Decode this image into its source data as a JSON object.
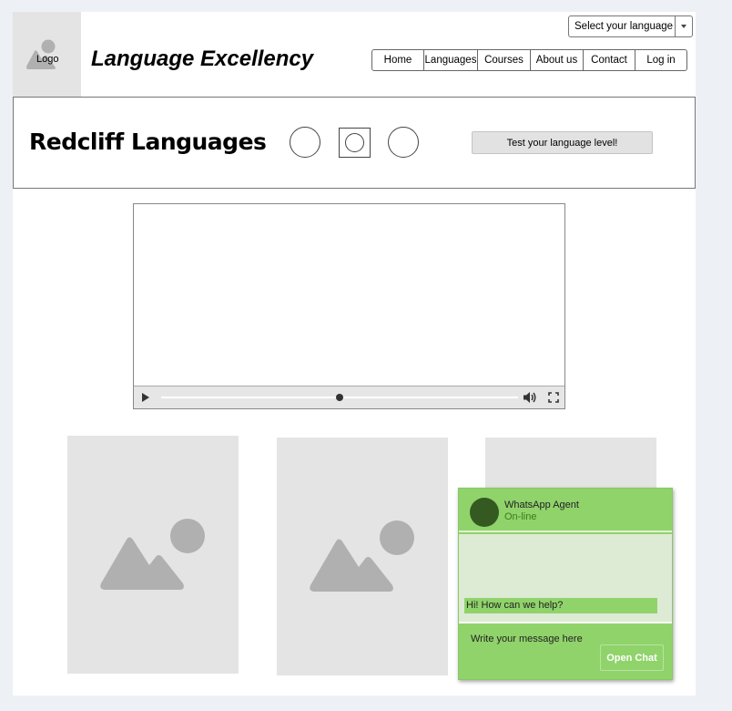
{
  "header": {
    "logo_label": "Logo",
    "site_title": "Language Excellency",
    "language_select": {
      "value": "Select your language"
    },
    "nav": [
      {
        "label": "Home",
        "w": 58
      },
      {
        "label": "Languages",
        "w": 60
      },
      {
        "label": "Courses",
        "w": 59
      },
      {
        "label": "About us",
        "w": 59
      },
      {
        "label": "Contact",
        "w": 58
      },
      {
        "label": "Log in",
        "w": 58
      }
    ]
  },
  "banner": {
    "brand": "Redcliff Languages",
    "test_button": "Test your language level!"
  },
  "video": {
    "progress": 0.5
  },
  "chat": {
    "agent_name": "WhatsApp Agent",
    "agent_status": "On-line",
    "greeting": "Hi! How can we help?",
    "message_placeholder": "Write your message here",
    "open_button": "Open Chat",
    "colors": {
      "panel": "#90d36b",
      "body": "#ddebd5",
      "avatar": "#345a21"
    }
  }
}
